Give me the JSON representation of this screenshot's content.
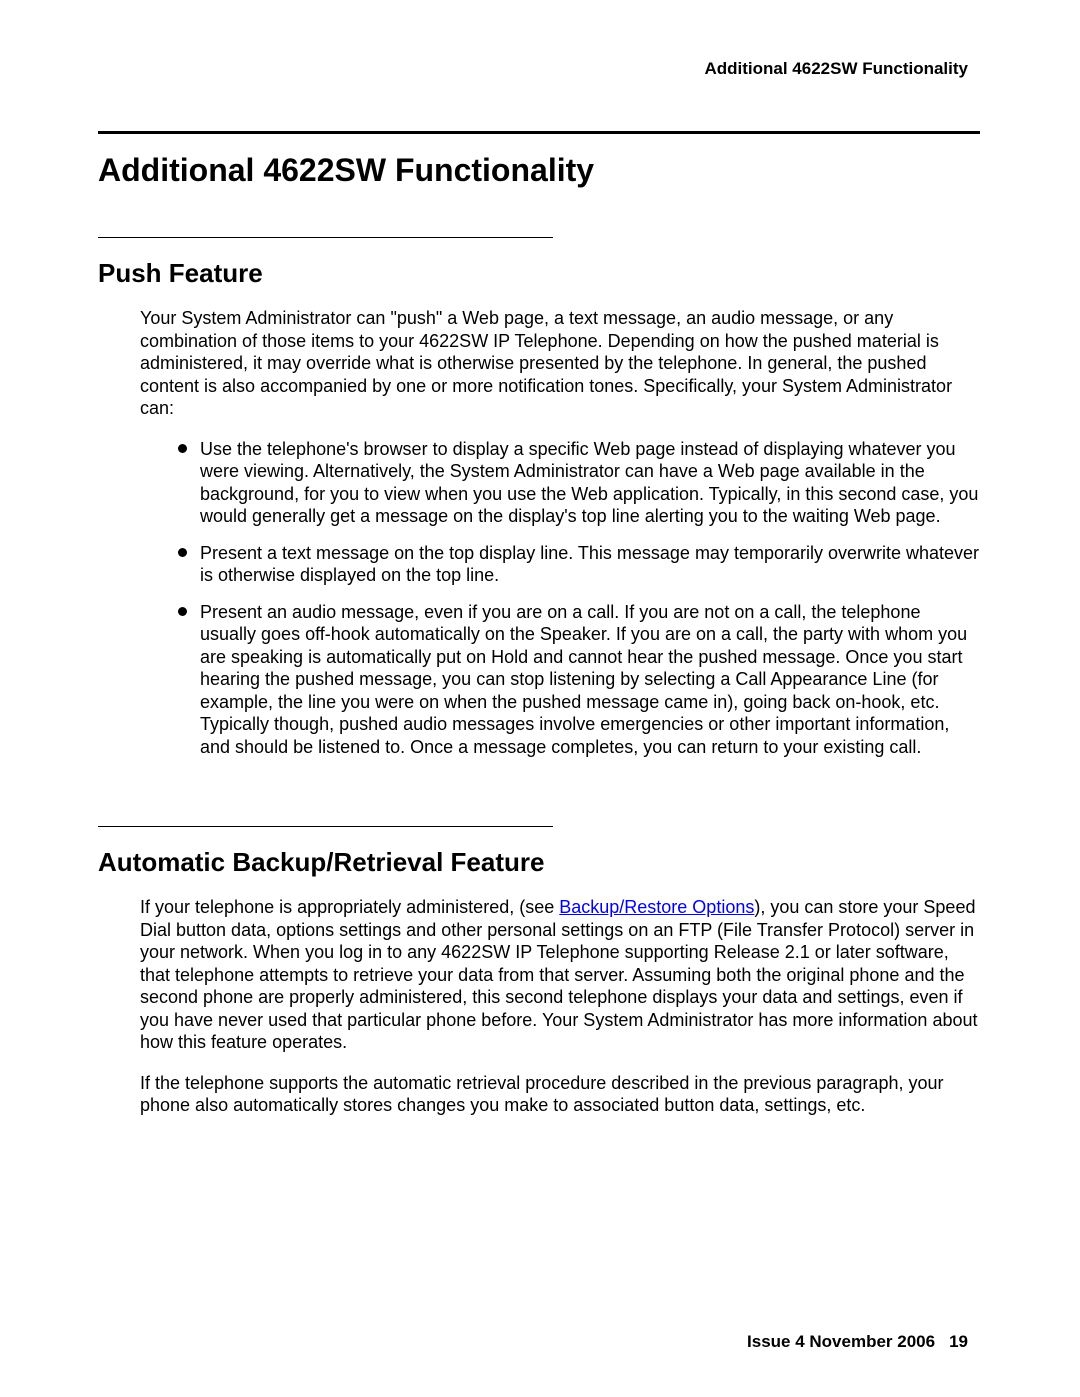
{
  "running_header": "Additional 4622SW Functionality",
  "main_heading": "Additional 4622SW Functionality",
  "section1": {
    "heading": "Push Feature",
    "intro": "Your System Administrator can \"push\" a Web page, a text message, an audio message, or any combination of those items to your 4622SW IP Telephone. Depending on how the pushed material is administered, it may override what is otherwise presented by the telephone. In general, the pushed content is also accompanied by one or more notification tones. Specifically, your System Administrator can:",
    "bullets": [
      "Use the telephone's browser to display a specific Web page instead of displaying whatever you were viewing. Alternatively, the System Administrator can have a Web page available in the background, for you to view when you use the Web application. Typically, in this second case, you would generally get a message on the display's top line alerting you to the waiting Web page.",
      "Present a text message on the top display line. This message may temporarily overwrite whatever is otherwise displayed on the top line.",
      "Present an audio message, even if you are on a call. If you are not on a call, the telephone usually goes off-hook automatically on the Speaker. If you are on a call, the party with whom you are speaking is automatically put on Hold and cannot hear the pushed message. Once you start hearing the pushed message, you can stop listening by selecting a Call Appearance Line (for example, the line you were on when the pushed message came in), going back on-hook, etc. Typically though, pushed audio messages involve emergencies or other important information, and should be listened to. Once a message completes, you can return to your existing call."
    ]
  },
  "section2": {
    "heading": "Automatic Backup/Retrieval Feature",
    "para1_pre": "If your telephone is appropriately administered, (see ",
    "para1_link": "Backup/Restore Options",
    "para1_post": "), you can store your Speed Dial button data, options settings and other personal settings on an FTP (File Transfer Protocol) server in your network. When you log in to any 4622SW IP Telephone supporting Release 2.1 or later software, that telephone attempts to retrieve your data from that server. Assuming both the original phone and the second phone are properly administered, this second telephone displays your data and settings, even if you have never used that particular phone before. Your System Administrator has more information about how this feature operates.",
    "para2": "If the telephone supports the automatic retrieval procedure described in the previous paragraph, your phone also automatically stores changes you make to associated button data, settings, etc."
  },
  "footer": {
    "issue_text": "Issue 4   November 2006",
    "page_number": "19"
  }
}
